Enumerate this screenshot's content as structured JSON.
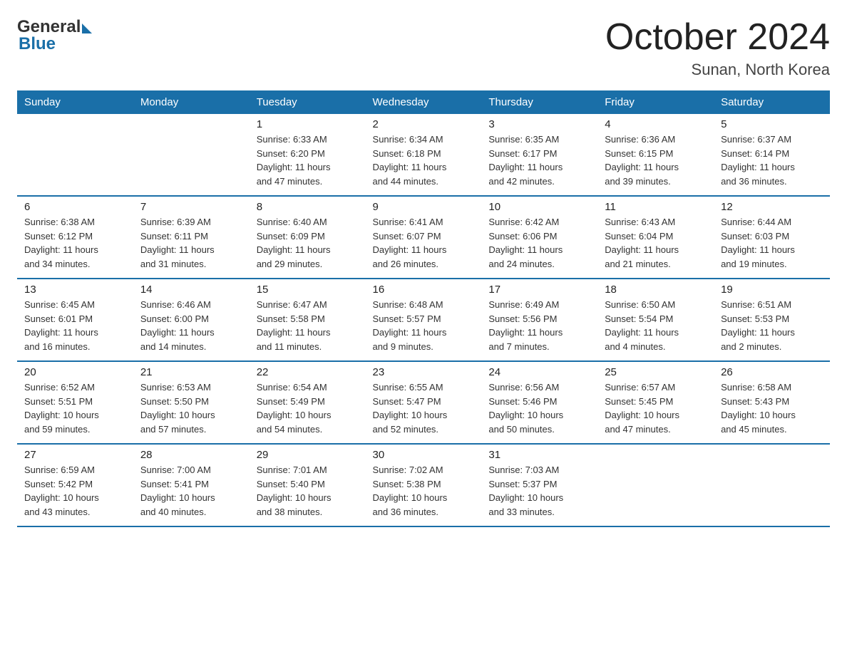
{
  "logo": {
    "general": "General",
    "blue": "Blue"
  },
  "title": "October 2024",
  "location": "Sunan, North Korea",
  "days_of_week": [
    "Sunday",
    "Monday",
    "Tuesday",
    "Wednesday",
    "Thursday",
    "Friday",
    "Saturday"
  ],
  "weeks": [
    [
      {
        "day": "",
        "info": ""
      },
      {
        "day": "",
        "info": ""
      },
      {
        "day": "1",
        "info": "Sunrise: 6:33 AM\nSunset: 6:20 PM\nDaylight: 11 hours\nand 47 minutes."
      },
      {
        "day": "2",
        "info": "Sunrise: 6:34 AM\nSunset: 6:18 PM\nDaylight: 11 hours\nand 44 minutes."
      },
      {
        "day": "3",
        "info": "Sunrise: 6:35 AM\nSunset: 6:17 PM\nDaylight: 11 hours\nand 42 minutes."
      },
      {
        "day": "4",
        "info": "Sunrise: 6:36 AM\nSunset: 6:15 PM\nDaylight: 11 hours\nand 39 minutes."
      },
      {
        "day": "5",
        "info": "Sunrise: 6:37 AM\nSunset: 6:14 PM\nDaylight: 11 hours\nand 36 minutes."
      }
    ],
    [
      {
        "day": "6",
        "info": "Sunrise: 6:38 AM\nSunset: 6:12 PM\nDaylight: 11 hours\nand 34 minutes."
      },
      {
        "day": "7",
        "info": "Sunrise: 6:39 AM\nSunset: 6:11 PM\nDaylight: 11 hours\nand 31 minutes."
      },
      {
        "day": "8",
        "info": "Sunrise: 6:40 AM\nSunset: 6:09 PM\nDaylight: 11 hours\nand 29 minutes."
      },
      {
        "day": "9",
        "info": "Sunrise: 6:41 AM\nSunset: 6:07 PM\nDaylight: 11 hours\nand 26 minutes."
      },
      {
        "day": "10",
        "info": "Sunrise: 6:42 AM\nSunset: 6:06 PM\nDaylight: 11 hours\nand 24 minutes."
      },
      {
        "day": "11",
        "info": "Sunrise: 6:43 AM\nSunset: 6:04 PM\nDaylight: 11 hours\nand 21 minutes."
      },
      {
        "day": "12",
        "info": "Sunrise: 6:44 AM\nSunset: 6:03 PM\nDaylight: 11 hours\nand 19 minutes."
      }
    ],
    [
      {
        "day": "13",
        "info": "Sunrise: 6:45 AM\nSunset: 6:01 PM\nDaylight: 11 hours\nand 16 minutes."
      },
      {
        "day": "14",
        "info": "Sunrise: 6:46 AM\nSunset: 6:00 PM\nDaylight: 11 hours\nand 14 minutes."
      },
      {
        "day": "15",
        "info": "Sunrise: 6:47 AM\nSunset: 5:58 PM\nDaylight: 11 hours\nand 11 minutes."
      },
      {
        "day": "16",
        "info": "Sunrise: 6:48 AM\nSunset: 5:57 PM\nDaylight: 11 hours\nand 9 minutes."
      },
      {
        "day": "17",
        "info": "Sunrise: 6:49 AM\nSunset: 5:56 PM\nDaylight: 11 hours\nand 7 minutes."
      },
      {
        "day": "18",
        "info": "Sunrise: 6:50 AM\nSunset: 5:54 PM\nDaylight: 11 hours\nand 4 minutes."
      },
      {
        "day": "19",
        "info": "Sunrise: 6:51 AM\nSunset: 5:53 PM\nDaylight: 11 hours\nand 2 minutes."
      }
    ],
    [
      {
        "day": "20",
        "info": "Sunrise: 6:52 AM\nSunset: 5:51 PM\nDaylight: 10 hours\nand 59 minutes."
      },
      {
        "day": "21",
        "info": "Sunrise: 6:53 AM\nSunset: 5:50 PM\nDaylight: 10 hours\nand 57 minutes."
      },
      {
        "day": "22",
        "info": "Sunrise: 6:54 AM\nSunset: 5:49 PM\nDaylight: 10 hours\nand 54 minutes."
      },
      {
        "day": "23",
        "info": "Sunrise: 6:55 AM\nSunset: 5:47 PM\nDaylight: 10 hours\nand 52 minutes."
      },
      {
        "day": "24",
        "info": "Sunrise: 6:56 AM\nSunset: 5:46 PM\nDaylight: 10 hours\nand 50 minutes."
      },
      {
        "day": "25",
        "info": "Sunrise: 6:57 AM\nSunset: 5:45 PM\nDaylight: 10 hours\nand 47 minutes."
      },
      {
        "day": "26",
        "info": "Sunrise: 6:58 AM\nSunset: 5:43 PM\nDaylight: 10 hours\nand 45 minutes."
      }
    ],
    [
      {
        "day": "27",
        "info": "Sunrise: 6:59 AM\nSunset: 5:42 PM\nDaylight: 10 hours\nand 43 minutes."
      },
      {
        "day": "28",
        "info": "Sunrise: 7:00 AM\nSunset: 5:41 PM\nDaylight: 10 hours\nand 40 minutes."
      },
      {
        "day": "29",
        "info": "Sunrise: 7:01 AM\nSunset: 5:40 PM\nDaylight: 10 hours\nand 38 minutes."
      },
      {
        "day": "30",
        "info": "Sunrise: 7:02 AM\nSunset: 5:38 PM\nDaylight: 10 hours\nand 36 minutes."
      },
      {
        "day": "31",
        "info": "Sunrise: 7:03 AM\nSunset: 5:37 PM\nDaylight: 10 hours\nand 33 minutes."
      },
      {
        "day": "",
        "info": ""
      },
      {
        "day": "",
        "info": ""
      }
    ]
  ]
}
